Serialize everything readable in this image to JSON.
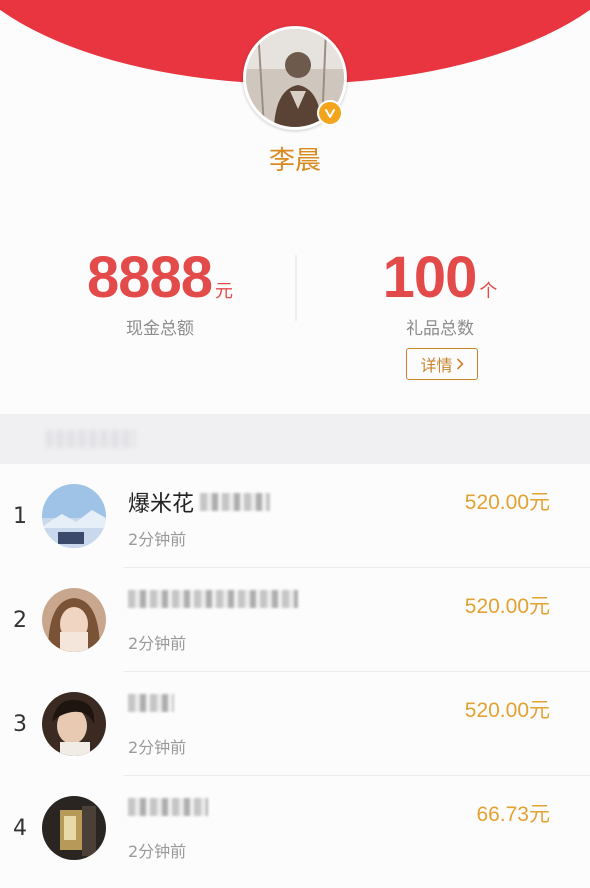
{
  "host": {
    "name": "李晨",
    "verified_icon": "verified-badge-icon"
  },
  "stats": {
    "cash_total": "8888",
    "cash_unit": "元",
    "cash_label": "现金总额",
    "gift_total": "100",
    "gift_unit": "个",
    "gift_label": "礼品总数",
    "detail_label": "详情",
    "detail_icon": "chevron-right-icon"
  },
  "colors": {
    "header_red": "#e8353f",
    "stat_red": "#e34a4a",
    "gold": "#d98a20",
    "amount_gold": "#e2a232"
  },
  "senders": [
    {
      "rank": "1",
      "name": "爆米花",
      "time": "2分钟前",
      "amount": "520.00元"
    },
    {
      "rank": "2",
      "name": "",
      "time": "2分钟前",
      "amount": "520.00元"
    },
    {
      "rank": "3",
      "name": "",
      "time": "2分钟前",
      "amount": "520.00元"
    },
    {
      "rank": "4",
      "name": "",
      "time": "2分钟前",
      "amount": "66.73元"
    }
  ]
}
